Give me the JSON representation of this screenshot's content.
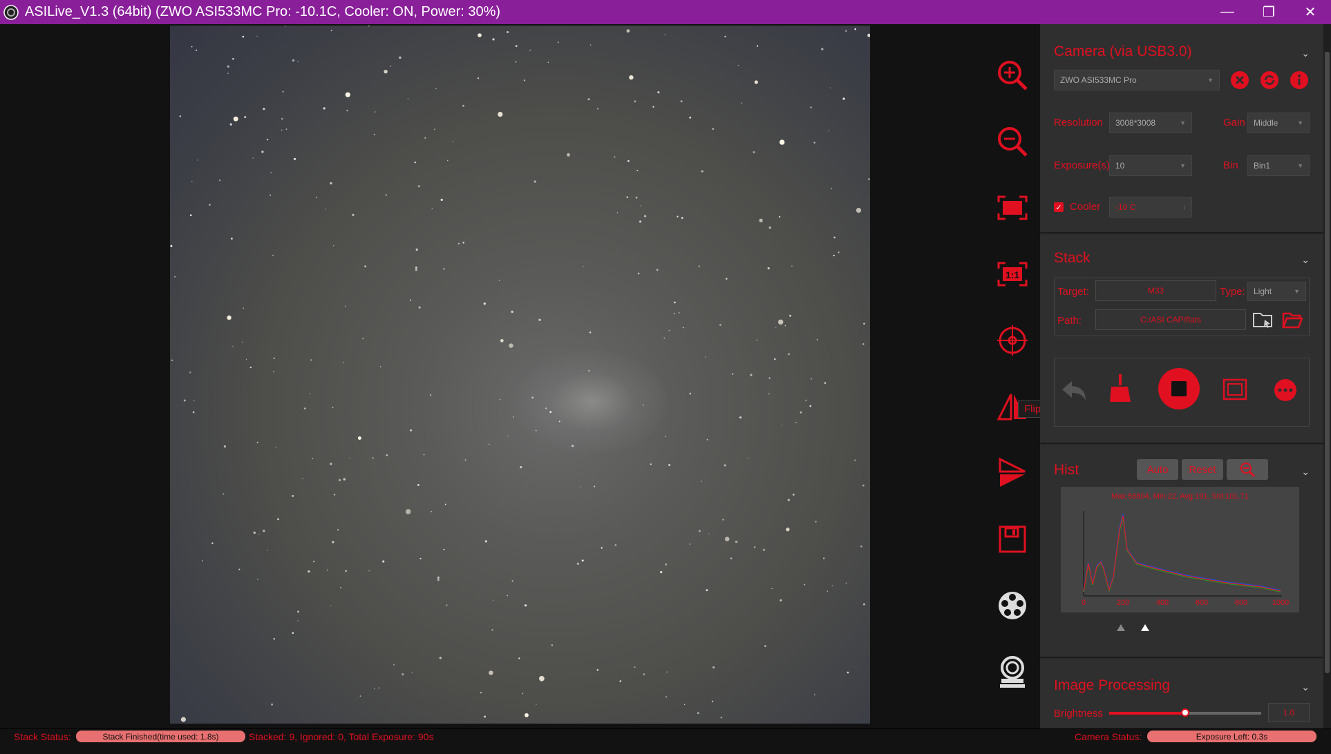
{
  "window": {
    "title": "ASILive_V1.3 (64bit)  (ZWO ASI533MC Pro: -10.1C, Cooler: ON, Power: 30%)"
  },
  "toolbar": {
    "tooltip": "Flip image horizontally",
    "icons": [
      "zoom-in-icon",
      "zoom-out-icon",
      "fit-window-icon",
      "actual-size-icon",
      "crosshair-icon",
      "flip-horizontal-icon",
      "flip-vertical-icon",
      "save-icon",
      "filter-wheel-icon",
      "focuser-icon"
    ]
  },
  "camera": {
    "title": "Camera (via USB3.0)",
    "device": "ZWO ASI533MC Pro",
    "resolution_label": "Resolution",
    "resolution": "3008*3008",
    "gain_label": "Gain",
    "gain": "Middle",
    "exposure_label": "Exposure(s)",
    "exposure": "10",
    "bin_label": "Bin",
    "bin": "Bin1",
    "cooler_label": "Cooler",
    "cooler_checked": true,
    "cooler_temp": "-10 C"
  },
  "stack": {
    "title": "Stack",
    "target_label": "Target:",
    "target": "M33",
    "type_label": "Type:",
    "type": "Light",
    "path_label": "Path:",
    "path": "C:/ASI CAP/flats"
  },
  "hist": {
    "title": "Hist",
    "auto_label": "Auto",
    "reset_label": "Reset",
    "stats": "Max:56804, Min:22, Avg:191, Std:101.71",
    "x_ticks": [
      "0",
      "200",
      "400",
      "600",
      "800",
      "1000"
    ]
  },
  "processing": {
    "title": "Image Processing",
    "brightness_label": "Brightness",
    "brightness": "1.0",
    "brightness_level": 0.5
  },
  "status": {
    "stack_status_label": "Stack Status:",
    "stack_status": "Stack Finished(time used: 1.8s)",
    "stack_summary": "Stacked: 9, Ignored: 0, Total Exposure: 90s",
    "camera_status_label": "Camera Status:",
    "camera_status": "Exposure Left: 0.3s"
  }
}
